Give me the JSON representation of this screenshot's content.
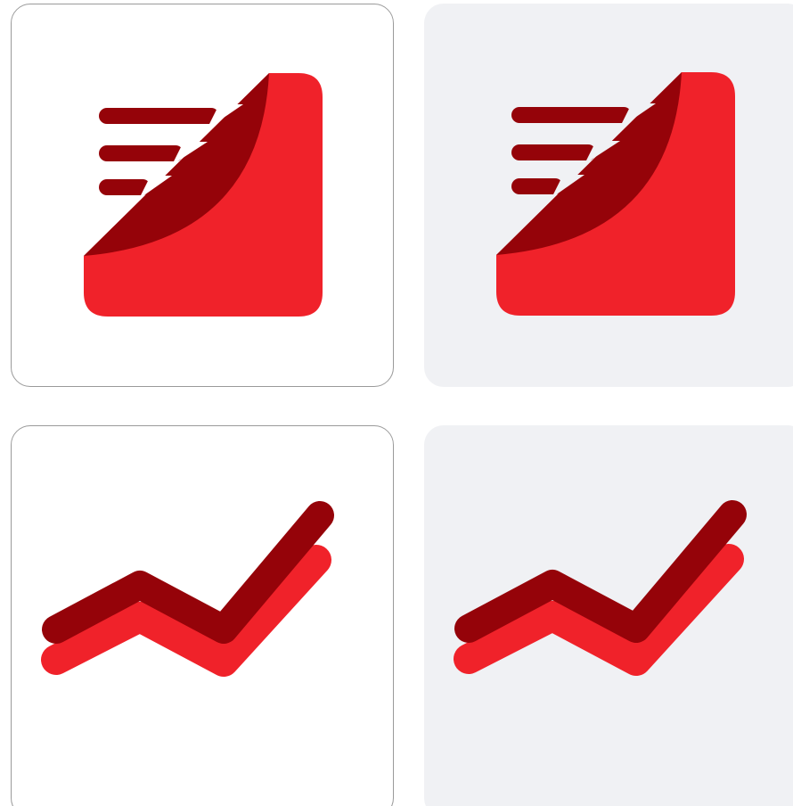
{
  "icons": [
    {
      "name": "feed-reader-icon",
      "variant": "white-background"
    },
    {
      "name": "feed-reader-icon",
      "variant": "gray-background"
    },
    {
      "name": "trend-line-icon",
      "variant": "white-background"
    },
    {
      "name": "trend-line-icon",
      "variant": "gray-background"
    }
  ],
  "colors": {
    "primary_red": "#f0222a",
    "dark_red": "#950309",
    "tile_gray": "#f0f1f4",
    "tile_border": "#9a9a9a"
  }
}
